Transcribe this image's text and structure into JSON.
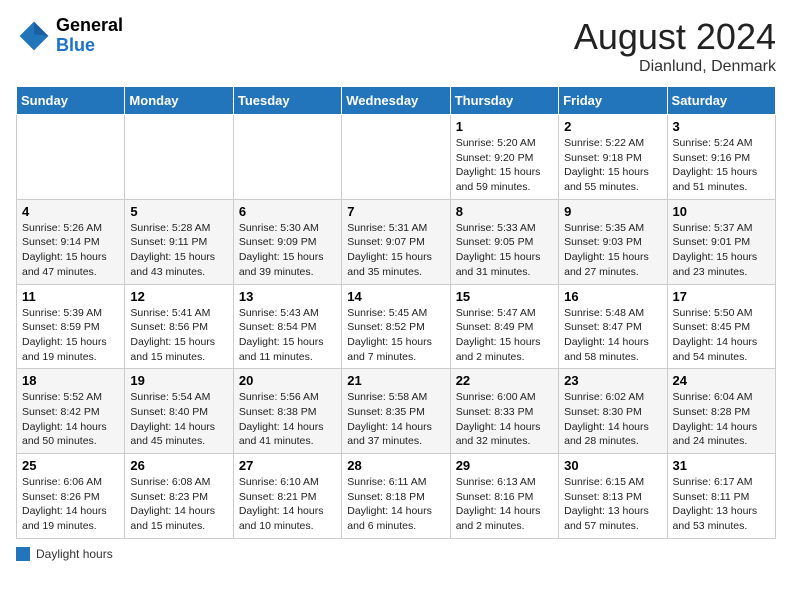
{
  "header": {
    "logo_general": "General",
    "logo_blue": "Blue",
    "month_year": "August 2024",
    "location": "Dianlund, Denmark"
  },
  "days_of_week": [
    "Sunday",
    "Monday",
    "Tuesday",
    "Wednesday",
    "Thursday",
    "Friday",
    "Saturday"
  ],
  "weeks": [
    [
      {
        "day": "",
        "sunrise": "",
        "sunset": "",
        "daylight": ""
      },
      {
        "day": "",
        "sunrise": "",
        "sunset": "",
        "daylight": ""
      },
      {
        "day": "",
        "sunrise": "",
        "sunset": "",
        "daylight": ""
      },
      {
        "day": "",
        "sunrise": "",
        "sunset": "",
        "daylight": ""
      },
      {
        "day": "1",
        "sunrise": "5:20 AM",
        "sunset": "9:20 PM",
        "daylight": "15 hours and 59 minutes."
      },
      {
        "day": "2",
        "sunrise": "5:22 AM",
        "sunset": "9:18 PM",
        "daylight": "15 hours and 55 minutes."
      },
      {
        "day": "3",
        "sunrise": "5:24 AM",
        "sunset": "9:16 PM",
        "daylight": "15 hours and 51 minutes."
      }
    ],
    [
      {
        "day": "4",
        "sunrise": "5:26 AM",
        "sunset": "9:14 PM",
        "daylight": "15 hours and 47 minutes."
      },
      {
        "day": "5",
        "sunrise": "5:28 AM",
        "sunset": "9:11 PM",
        "daylight": "15 hours and 43 minutes."
      },
      {
        "day": "6",
        "sunrise": "5:30 AM",
        "sunset": "9:09 PM",
        "daylight": "15 hours and 39 minutes."
      },
      {
        "day": "7",
        "sunrise": "5:31 AM",
        "sunset": "9:07 PM",
        "daylight": "15 hours and 35 minutes."
      },
      {
        "day": "8",
        "sunrise": "5:33 AM",
        "sunset": "9:05 PM",
        "daylight": "15 hours and 31 minutes."
      },
      {
        "day": "9",
        "sunrise": "5:35 AM",
        "sunset": "9:03 PM",
        "daylight": "15 hours and 27 minutes."
      },
      {
        "day": "10",
        "sunrise": "5:37 AM",
        "sunset": "9:01 PM",
        "daylight": "15 hours and 23 minutes."
      }
    ],
    [
      {
        "day": "11",
        "sunrise": "5:39 AM",
        "sunset": "8:59 PM",
        "daylight": "15 hours and 19 minutes."
      },
      {
        "day": "12",
        "sunrise": "5:41 AM",
        "sunset": "8:56 PM",
        "daylight": "15 hours and 15 minutes."
      },
      {
        "day": "13",
        "sunrise": "5:43 AM",
        "sunset": "8:54 PM",
        "daylight": "15 hours and 11 minutes."
      },
      {
        "day": "14",
        "sunrise": "5:45 AM",
        "sunset": "8:52 PM",
        "daylight": "15 hours and 7 minutes."
      },
      {
        "day": "15",
        "sunrise": "5:47 AM",
        "sunset": "8:49 PM",
        "daylight": "15 hours and 2 minutes."
      },
      {
        "day": "16",
        "sunrise": "5:48 AM",
        "sunset": "8:47 PM",
        "daylight": "14 hours and 58 minutes."
      },
      {
        "day": "17",
        "sunrise": "5:50 AM",
        "sunset": "8:45 PM",
        "daylight": "14 hours and 54 minutes."
      }
    ],
    [
      {
        "day": "18",
        "sunrise": "5:52 AM",
        "sunset": "8:42 PM",
        "daylight": "14 hours and 50 minutes."
      },
      {
        "day": "19",
        "sunrise": "5:54 AM",
        "sunset": "8:40 PM",
        "daylight": "14 hours and 45 minutes."
      },
      {
        "day": "20",
        "sunrise": "5:56 AM",
        "sunset": "8:38 PM",
        "daylight": "14 hours and 41 minutes."
      },
      {
        "day": "21",
        "sunrise": "5:58 AM",
        "sunset": "8:35 PM",
        "daylight": "14 hours and 37 minutes."
      },
      {
        "day": "22",
        "sunrise": "6:00 AM",
        "sunset": "8:33 PM",
        "daylight": "14 hours and 32 minutes."
      },
      {
        "day": "23",
        "sunrise": "6:02 AM",
        "sunset": "8:30 PM",
        "daylight": "14 hours and 28 minutes."
      },
      {
        "day": "24",
        "sunrise": "6:04 AM",
        "sunset": "8:28 PM",
        "daylight": "14 hours and 24 minutes."
      }
    ],
    [
      {
        "day": "25",
        "sunrise": "6:06 AM",
        "sunset": "8:26 PM",
        "daylight": "14 hours and 19 minutes."
      },
      {
        "day": "26",
        "sunrise": "6:08 AM",
        "sunset": "8:23 PM",
        "daylight": "14 hours and 15 minutes."
      },
      {
        "day": "27",
        "sunrise": "6:10 AM",
        "sunset": "8:21 PM",
        "daylight": "14 hours and 10 minutes."
      },
      {
        "day": "28",
        "sunrise": "6:11 AM",
        "sunset": "8:18 PM",
        "daylight": "14 hours and 6 minutes."
      },
      {
        "day": "29",
        "sunrise": "6:13 AM",
        "sunset": "8:16 PM",
        "daylight": "14 hours and 2 minutes."
      },
      {
        "day": "30",
        "sunrise": "6:15 AM",
        "sunset": "8:13 PM",
        "daylight": "13 hours and 57 minutes."
      },
      {
        "day": "31",
        "sunrise": "6:17 AM",
        "sunset": "8:11 PM",
        "daylight": "13 hours and 53 minutes."
      }
    ]
  ],
  "legend": {
    "label": "Daylight hours",
    "color": "#2275bb"
  }
}
